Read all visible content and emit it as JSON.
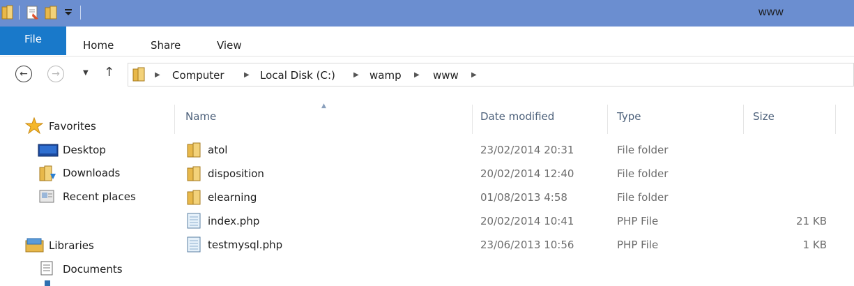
{
  "window": {
    "title": "www"
  },
  "quick_access": {
    "icons": [
      "folder-icon",
      "properties-icon",
      "new-folder-icon",
      "customize-dropdown-icon"
    ]
  },
  "ribbon": {
    "tabs": [
      {
        "label": "File"
      },
      {
        "label": "Home"
      },
      {
        "label": "Share"
      },
      {
        "label": "View"
      }
    ]
  },
  "address": {
    "crumbs": [
      "Computer",
      "Local Disk (C:)",
      "wamp",
      "www"
    ]
  },
  "navpane": {
    "favorites": {
      "label": "Favorites",
      "items": [
        {
          "label": "Desktop"
        },
        {
          "label": "Downloads"
        },
        {
          "label": "Recent places"
        }
      ]
    },
    "libraries": {
      "label": "Libraries",
      "items": [
        {
          "label": "Documents"
        }
      ]
    }
  },
  "columns": {
    "name": "Name",
    "date": "Date modified",
    "type": "Type",
    "size": "Size"
  },
  "files": [
    {
      "name": "atol",
      "date": "23/02/2014 20:31",
      "type": "File folder",
      "size": "",
      "icon": "folder-icon"
    },
    {
      "name": "disposition",
      "date": "20/02/2014 12:40",
      "type": "File folder",
      "size": "",
      "icon": "folder-icon"
    },
    {
      "name": "elearning",
      "date": "01/08/2013 4:58",
      "type": "File folder",
      "size": "",
      "icon": "folder-icon"
    },
    {
      "name": "index.php",
      "date": "20/02/2014 10:41",
      "type": "PHP File",
      "size": "21 KB",
      "icon": "php-file-icon"
    },
    {
      "name": "testmysql.php",
      "date": "23/06/2013 10:56",
      "type": "PHP File",
      "size": "1 KB",
      "icon": "php-file-icon"
    }
  ],
  "colors": {
    "titlebar": "#6b8ed0",
    "file_tab": "#1979ca",
    "folder": "#e8b84a"
  }
}
